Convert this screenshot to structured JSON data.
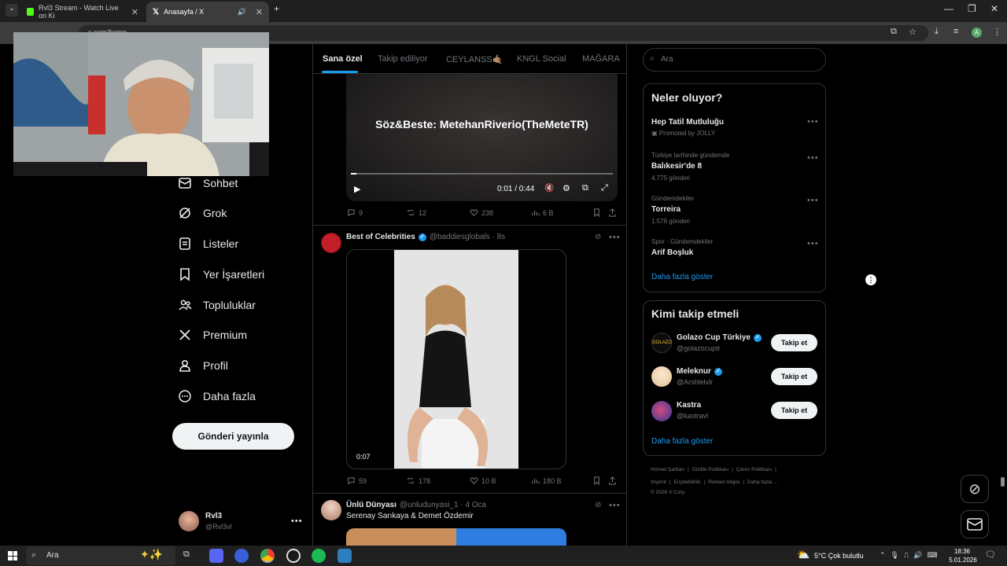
{
  "browser": {
    "tabs": [
      {
        "title": "Rvl3 Stream - Watch Live on Ki"
      },
      {
        "title": "Anasayfa / X"
      }
    ],
    "address": "x.com/home"
  },
  "nav": {
    "items": [
      {
        "label": "Sohbet"
      },
      {
        "label": "Grok"
      },
      {
        "label": "Listeler"
      },
      {
        "label": "Yer İşaretleri"
      },
      {
        "label": "Topluluklar"
      },
      {
        "label": "Premium"
      },
      {
        "label": "Profil"
      },
      {
        "label": "Daha fazla"
      }
    ],
    "post_button": "Gönderi yayınla",
    "account": {
      "name": "Rvl3",
      "handle": "@Rvl3vl"
    }
  },
  "top_tabs": [
    "Sana özel",
    "Takip ediliyor",
    "CEYLANSS🤙🏽",
    "KNGL Social",
    "MAĞARA"
  ],
  "video_post": {
    "overlay_title": "Söz&Beste: MetehanRiverio(TheMeteTR)",
    "time": "0:01 / 0:44",
    "progress": 0.02,
    "stats": {
      "replies": "9",
      "reposts": "12",
      "likes": "238",
      "views": "6 B"
    }
  },
  "celeb_post": {
    "author": "Best of Celebrities",
    "handle": "@baddiesglobals · 8s",
    "video_time": "0:07",
    "stats": {
      "replies": "59",
      "reposts": "178",
      "likes": "10 B",
      "views": "180 B"
    }
  },
  "unlu_post": {
    "author": "Ünlü Dünyası",
    "handle": "@unludunyasi_1 · 4 Oca",
    "text": "Serenay Sarıkaya & Demet Özdemir"
  },
  "search": {
    "placeholder": "Ara"
  },
  "trends": {
    "title": "Neler oluyor?",
    "items": [
      {
        "context": "",
        "name": "Hep Tatil Mutluluğu",
        "meta": "Promoted by JOLLY"
      },
      {
        "context": "Türkiye tarihinde gündemde",
        "name": "Balıkesir'de 8",
        "meta": "4.775 gönderi"
      },
      {
        "context": "Gündemdekiler",
        "name": "Torreira",
        "meta": "1.576 gönderi"
      },
      {
        "context": "Spor · Gündemdekiler",
        "name": "Arif Boşluk",
        "meta": ""
      }
    ],
    "more": "Daha fazla göster"
  },
  "who_to_follow": {
    "title": "Kimi takip etmeli",
    "items": [
      {
        "name": "Golazo Cup Türkiye",
        "handle": "@golazocuptr",
        "button": "Takip et"
      },
      {
        "name": "Meleknur",
        "handle": "@Arshlelvlr",
        "button": "Takip et"
      },
      {
        "name": "Kastra",
        "handle": "@kastravl",
        "button": "Takip et"
      }
    ],
    "more": "Daha fazla göster"
  },
  "footer": {
    "row1": [
      "Hizmet Şartları",
      "Gizlilik Politikası",
      "Çerez Politikası"
    ],
    "row2": [
      "Imprint",
      "Erişilebilirlik",
      "Reklam bilgisi",
      "Daha fazla ..."
    ],
    "copyright": "© 2026 X Corp."
  },
  "taskbar": {
    "search": "Ara",
    "weather": "5°C  Çok bulutlu",
    "time": "18:36",
    "date": "5.01.2026"
  },
  "colors": {
    "accent": "#1d9bf0",
    "verified": "#1d9bf0",
    "background": "#000000",
    "border": "#2f3336"
  }
}
